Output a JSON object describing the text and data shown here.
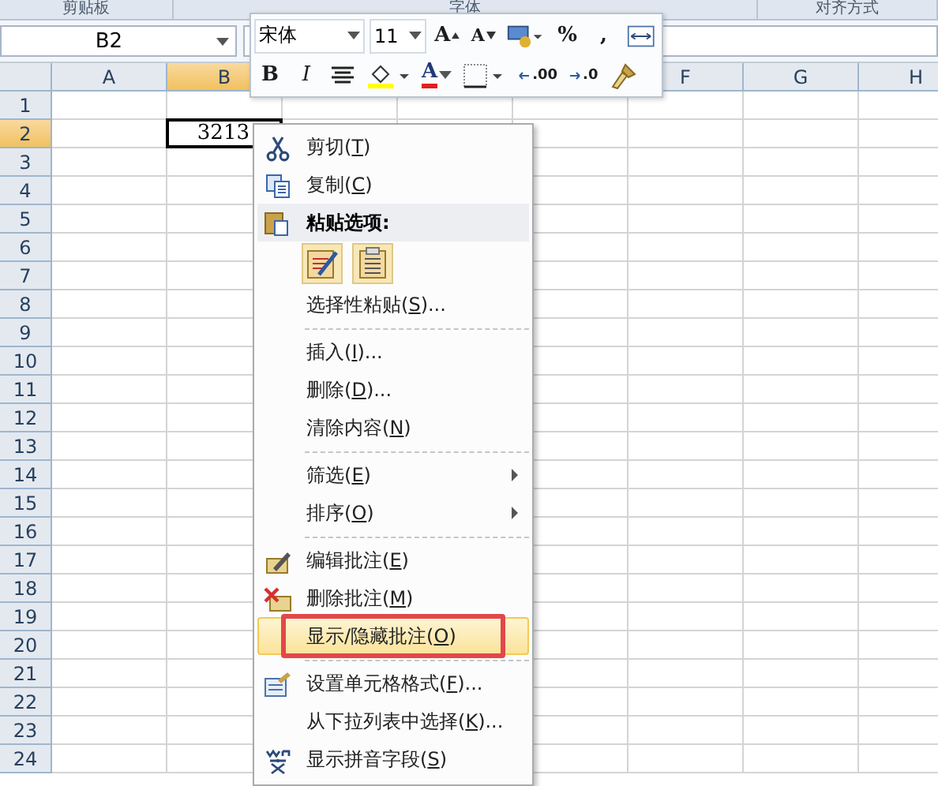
{
  "ribbon_groups": [
    "剪贴板",
    "字体",
    "对齐方式"
  ],
  "name_box": "B2",
  "columns_left": [
    {
      "label": "A",
      "selected": false
    },
    {
      "label": "B",
      "selected": true
    }
  ],
  "columns_right": [
    {
      "label": "F",
      "selected": false
    },
    {
      "label": "G",
      "selected": false
    },
    {
      "label": "H",
      "selected": false
    }
  ],
  "rows": [
    {
      "label": "1",
      "selected": false
    },
    {
      "label": "2",
      "selected": true,
      "value": "3213"
    },
    {
      "label": "3",
      "selected": false
    },
    {
      "label": "4",
      "selected": false
    },
    {
      "label": "5",
      "selected": false
    },
    {
      "label": "6",
      "selected": false
    },
    {
      "label": "7",
      "selected": false
    },
    {
      "label": "8",
      "selected": false
    },
    {
      "label": "9",
      "selected": false
    },
    {
      "label": "10",
      "selected": false
    },
    {
      "label": "11",
      "selected": false
    },
    {
      "label": "12",
      "selected": false
    },
    {
      "label": "13",
      "selected": false
    },
    {
      "label": "14",
      "selected": false
    },
    {
      "label": "15",
      "selected": false
    },
    {
      "label": "16",
      "selected": false
    },
    {
      "label": "17",
      "selected": false
    },
    {
      "label": "18",
      "selected": false
    },
    {
      "label": "19",
      "selected": false
    },
    {
      "label": "20",
      "selected": false
    },
    {
      "label": "21",
      "selected": false
    },
    {
      "label": "22",
      "selected": false
    },
    {
      "label": "23",
      "selected": false
    },
    {
      "label": "24",
      "selected": false
    }
  ],
  "mini_toolbar": {
    "font": "宋体",
    "size": "11",
    "row1": [
      {
        "kind": "grow-font",
        "label": "A"
      },
      {
        "kind": "shrink-font",
        "label": "A"
      },
      {
        "kind": "accounting"
      },
      {
        "kind": "percent",
        "label": "%"
      },
      {
        "kind": "comma",
        "label": ","
      },
      {
        "kind": "merge"
      }
    ],
    "row2": [
      {
        "kind": "bold",
        "label": "B"
      },
      {
        "kind": "italic",
        "label": "I"
      },
      {
        "kind": "center"
      },
      {
        "kind": "fill-color"
      },
      {
        "kind": "font-color",
        "label": "A"
      },
      {
        "kind": "borders"
      },
      {
        "kind": "increase-decimal",
        "label": ".00"
      },
      {
        "kind": "decrease-decimal",
        "label": ".0"
      },
      {
        "kind": "format-painter"
      }
    ]
  },
  "context_menu": [
    {
      "kind": "item",
      "text": "剪切(",
      "key": "T",
      "rest": ")",
      "submenu": false,
      "selected": false,
      "annotated": false
    },
    {
      "kind": "item",
      "text": "复制(",
      "key": "C",
      "rest": ")",
      "submenu": false,
      "selected": false,
      "annotated": false
    },
    {
      "kind": "header",
      "text": "粘贴选项:"
    },
    {
      "kind": "paste-icons"
    },
    {
      "kind": "item",
      "text": "选择性粘贴(",
      "key": "S",
      "rest": ")...",
      "submenu": false,
      "selected": false,
      "annotated": false
    },
    {
      "kind": "separator"
    },
    {
      "kind": "item",
      "text": "插入(",
      "key": "I",
      "rest": ")...",
      "submenu": false,
      "selected": false,
      "annotated": false
    },
    {
      "kind": "item",
      "text": "删除(",
      "key": "D",
      "rest": ")...",
      "submenu": false,
      "selected": false,
      "annotated": false
    },
    {
      "kind": "item",
      "text": "清除内容(",
      "key": "N",
      "rest": ")",
      "submenu": false,
      "selected": false,
      "annotated": false
    },
    {
      "kind": "separator"
    },
    {
      "kind": "item",
      "text": "筛选(",
      "key": "E",
      "rest": ")",
      "submenu": true,
      "selected": false,
      "annotated": false
    },
    {
      "kind": "item",
      "text": "排序(",
      "key": "O",
      "rest": ")",
      "submenu": true,
      "selected": false,
      "annotated": false
    },
    {
      "kind": "separator"
    },
    {
      "kind": "item",
      "text": "编辑批注(",
      "key": "E",
      "rest": ")",
      "submenu": false,
      "selected": false,
      "annotated": false
    },
    {
      "kind": "item",
      "text": "删除批注(",
      "key": "M",
      "rest": ")",
      "submenu": false,
      "selected": false,
      "annotated": false
    },
    {
      "kind": "item",
      "text": "显示/隐藏批注(",
      "key": "O",
      "rest": ")",
      "submenu": false,
      "selected": true,
      "annotated": true
    },
    {
      "kind": "separator"
    },
    {
      "kind": "item",
      "text": "设置单元格格式(",
      "key": "F",
      "rest": ")...",
      "submenu": false,
      "selected": false,
      "annotated": false
    },
    {
      "kind": "item",
      "text": "从下拉列表中选择(",
      "key": "K",
      "rest": ")...",
      "submenu": false,
      "selected": false,
      "annotated": false
    },
    {
      "kind": "item",
      "text": "显示拼音字段(",
      "key": "S",
      "rest": ")",
      "submenu": false,
      "selected": false,
      "annotated": false
    }
  ]
}
